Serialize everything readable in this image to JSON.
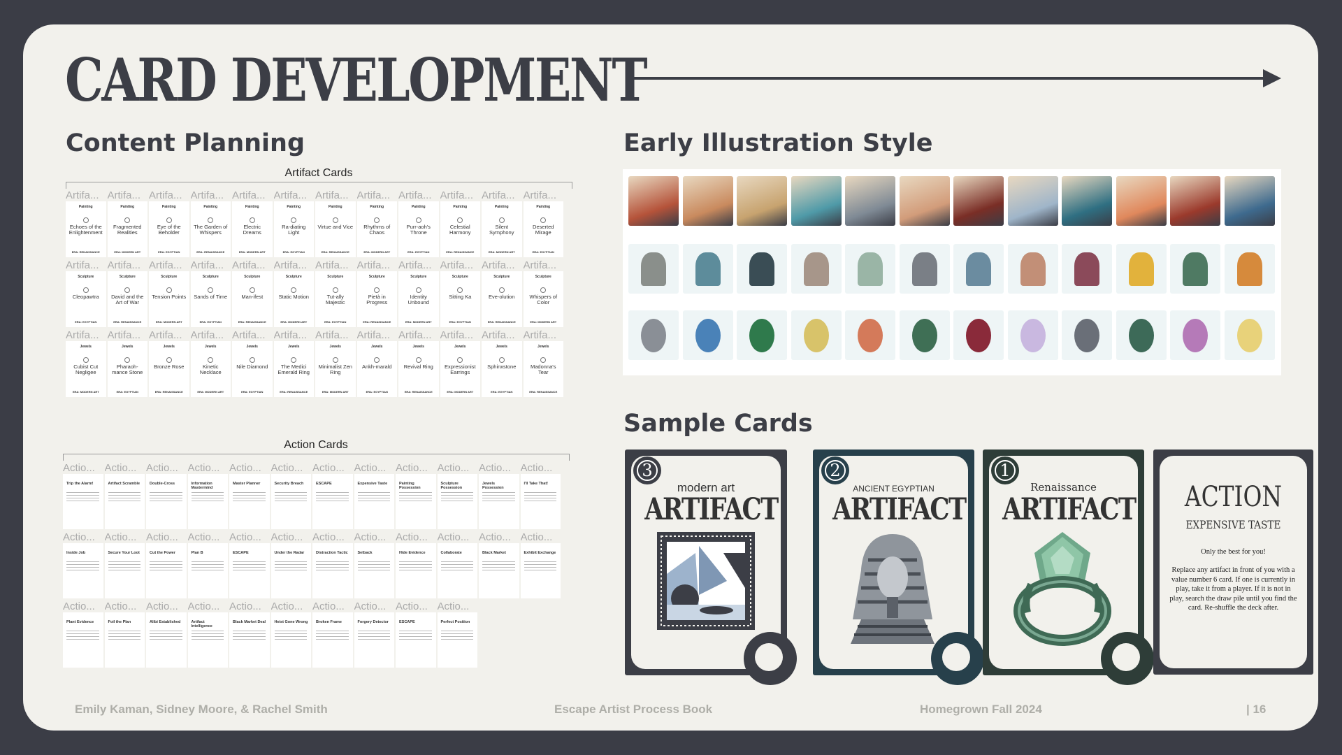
{
  "title": "CARD DEVELOPMENT",
  "content_planning": {
    "heading": "Content Planning",
    "artifact_cards": {
      "label": "Artifact Cards",
      "column_header": "Artifa...",
      "rows": [
        {
          "category": "Painting",
          "cards": [
            {
              "name": "Echoes of the Enlightenment",
              "era": "ERA: RENAISSANCE"
            },
            {
              "name": "Fragmented Realities",
              "era": "ERA: MODERN ART"
            },
            {
              "name": "Eye of the Beholder",
              "era": "ERA: EGYPTIAN"
            },
            {
              "name": "The Garden of Whispers",
              "era": "ERA: RENAISSANCE"
            },
            {
              "name": "Electric Dreams",
              "era": "ERA: MODERN ART"
            },
            {
              "name": "Ra-diating Light",
              "era": "ERA: EGYPTIAN"
            },
            {
              "name": "Virtue and Vice",
              "era": "ERA: RENAISSANCE"
            },
            {
              "name": "Rhythms of Chaos",
              "era": "ERA: MODERN ART"
            },
            {
              "name": "Purr-aoh's Throne",
              "era": "ERA: EGYPTIAN"
            },
            {
              "name": "Celestial Harmony",
              "era": "ERA: RENAISSANCE"
            },
            {
              "name": "Silent Symphony",
              "era": "ERA: MODERN ART"
            },
            {
              "name": "Deserted Mirage",
              "era": "ERA: EGYPTIAN"
            }
          ]
        },
        {
          "category": "Sculpture",
          "cards": [
            {
              "name": "Cleopawtra",
              "era": "ERA: EGYPTIAN"
            },
            {
              "name": "David and the Art of War",
              "era": "ERA: RENAISSANCE"
            },
            {
              "name": "Tension Points",
              "era": "ERA: MODERN ART"
            },
            {
              "name": "Sands of Time",
              "era": "ERA: EGYPTIAN"
            },
            {
              "name": "Man-ifest",
              "era": "ERA: RENAISSANCE"
            },
            {
              "name": "Static Motion",
              "era": "ERA: MODERN ART"
            },
            {
              "name": "Tut-ally Majestic",
              "era": "ERA: EGYPTIAN"
            },
            {
              "name": "Pietà in Progress",
              "era": "ERA: RENAISSANCE"
            },
            {
              "name": "Identity Unbound",
              "era": "ERA: MODERN ART"
            },
            {
              "name": "Sitting Ka",
              "era": "ERA: EGYPTIAN"
            },
            {
              "name": "Eve-olution",
              "era": "ERA: RENAISSANCE"
            },
            {
              "name": "Whispers of Color",
              "era": "ERA: MODERN ART"
            }
          ]
        },
        {
          "category": "Jewels",
          "cards": [
            {
              "name": "Cubist Cut Negligee",
              "era": "ERA: MODERN ART"
            },
            {
              "name": "Pharaoh-mance Stone",
              "era": "ERA: EGYPTIAN"
            },
            {
              "name": "Bronze Rose",
              "era": "ERA: RENAISSANCE"
            },
            {
              "name": "Kinetic Necklace",
              "era": "ERA: MODERN ART"
            },
            {
              "name": "Nile Diamond",
              "era": "ERA: EGYPTIAN"
            },
            {
              "name": "The Medici Emerald Ring",
              "era": "ERA: RENAISSANCE"
            },
            {
              "name": "Minimalist Zen Ring",
              "era": "ERA: MODERN ART"
            },
            {
              "name": "Ankh-marald",
              "era": "ERA: EGYPTIAN"
            },
            {
              "name": "Revival Ring",
              "era": "ERA: RENAISSANCE"
            },
            {
              "name": "Expressionist Earrings",
              "era": "ERA: MODERN ART"
            },
            {
              "name": "Sphinxstone",
              "era": "ERA: EGYPTIAN"
            },
            {
              "name": "Madonna's Tear",
              "era": "ERA: RENAISSANCE"
            }
          ]
        }
      ]
    },
    "action_cards": {
      "label": "Action Cards",
      "column_header": "Actio...",
      "rows": [
        [
          "Trip the Alarm!",
          "Artifact Scramble",
          "Double-Cross",
          "Information Mastermind",
          "Master Planner",
          "Security Breach",
          "ESCAPE",
          "Expensive Taste",
          "Painting Possession",
          "Sculpture Possession",
          "Jewels Possession",
          "I'll Take That!"
        ],
        [
          "Inside Job",
          "Secure Your Loot",
          "Cut the Power",
          "Plan B",
          "ESCAPE",
          "Under the Radar",
          "Distraction Tactic",
          "Setback",
          "Hide Evidence",
          "Collaborate",
          "Black Market",
          "Exhibit Exchange"
        ],
        [
          "Plant Evidence",
          "Foil the Plan",
          "Alibi Established",
          "Artifact Intelligence",
          "Black Market Deal",
          "Heist Gone Wrong",
          "Broken Frame",
          "Forgery Detector",
          "ESCAPE",
          "Perfect Position"
        ]
      ]
    }
  },
  "illustration_style": {
    "heading": "Early Illustration Style",
    "rows": [
      {
        "colors": [
          "#b5533a",
          "#c98a5e",
          "#c7a36f",
          "#4f9aa8",
          "#7f8a95",
          "#d29c7a",
          "#7a2e26",
          "#9fb5c9",
          "#2f6f82",
          "#e0885c",
          "#9b3a2c",
          "#3e6a8e"
        ]
      },
      {
        "colors": [
          "#8a8f8b",
          "#5d8c9b",
          "#3a4d55",
          "#a7968a",
          "#9ab5a6",
          "#7a7f86",
          "#6b8ca0",
          "#c28f77",
          "#8b4a5a",
          "#e2b23c",
          "#4f7a63",
          "#d68a3c"
        ]
      },
      {
        "colors": [
          "#8a8f96",
          "#4a82b8",
          "#2f7a4c",
          "#d8c36a",
          "#d47a5a",
          "#3f6f55",
          "#8a2a3a",
          "#c9b8e0",
          "#6a6f78",
          "#3d6a58",
          "#b57ab8",
          "#e8d27a"
        ]
      }
    ]
  },
  "sample_cards": {
    "heading": "Sample Cards",
    "cards": [
      {
        "number": "3",
        "era": "modern art",
        "title": "ARTIFACT",
        "color": "#3c3e46"
      },
      {
        "number": "2",
        "era": "ANCIENT EGYPTIAN",
        "title": "ARTIFACT",
        "color": "#27404b"
      },
      {
        "number": "1",
        "era": "Renaissance",
        "title": "ARTIFACT",
        "color": "#2e3d38"
      }
    ],
    "action": {
      "title": "ACTION",
      "subtitle": "EXPENSIVE TASTE",
      "tagline": "Only the best for you!",
      "body": "Replace any artifact in front of you with a value number 6 card. If one is currently in play, take it from a player. If it is not in play, search the draw pile until you find the card. Re-shuffle the deck after.",
      "color": "#3c3e46"
    }
  },
  "footer": {
    "authors": "Emily Kaman, Sidney Moore, & Rachel Smith",
    "book": "Escape Artist Process Book",
    "term": "Homegrown Fall 2024",
    "page": "| 16"
  }
}
